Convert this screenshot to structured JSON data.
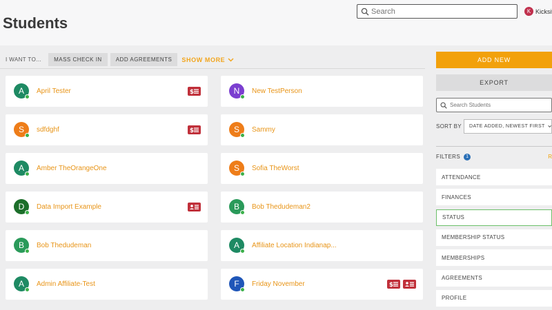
{
  "header": {
    "title": "Students",
    "search_placeholder": "Search",
    "user_initial": "K",
    "user_name": "Kicksite"
  },
  "actionbar": {
    "i_want_to": "I WANT TO...",
    "mass_check_in": "MASS CHECK IN",
    "add_agreements": "ADD AGREEMENTS",
    "show_more": "SHOW MORE"
  },
  "students": [
    {
      "initial": "A",
      "name": "April Tester",
      "avatar_color": "#1e8a63",
      "badges": [
        "finance-icon"
      ]
    },
    {
      "initial": "N",
      "name": "New TestPerson",
      "avatar_color": "#7b3fd0",
      "badges": []
    },
    {
      "initial": "S",
      "name": "sdfdghf",
      "avatar_color": "#ee7d19",
      "badges": [
        "finance-icon"
      ]
    },
    {
      "initial": "S",
      "name": "Sammy",
      "avatar_color": "#ee7d19",
      "badges": []
    },
    {
      "initial": "A",
      "name": "Amber TheOrangeOne",
      "avatar_color": "#1e8a63",
      "badges": []
    },
    {
      "initial": "S",
      "name": "Sofia TheWorst",
      "avatar_color": "#ee7d19",
      "badges": []
    },
    {
      "initial": "D",
      "name": "Data Import Example",
      "avatar_color": "#1c6e2a",
      "badges": [
        "id-card-icon"
      ]
    },
    {
      "initial": "B",
      "name": "Bob Thedudeman2",
      "avatar_color": "#2a9a5a",
      "badges": []
    },
    {
      "initial": "B",
      "name": "Bob Thedudeman",
      "avatar_color": "#2a9a5a",
      "badges": []
    },
    {
      "initial": "A",
      "name": "Affiliate Location Indianap...",
      "avatar_color": "#1e8a63",
      "badges": []
    },
    {
      "initial": "A",
      "name": "Admin Affiliate-Test",
      "avatar_color": "#1e8a63",
      "badges": []
    },
    {
      "initial": "F",
      "name": "Friday November",
      "avatar_color": "#1f56b8",
      "badges": [
        "finance-icon",
        "id-card-icon"
      ]
    }
  ],
  "sidebar": {
    "add_new": "ADD NEW",
    "export": "EXPORT",
    "search_placeholder": "Search Students",
    "sort_label": "SORT BY",
    "sort_value": "DATE ADDED, NEWEST FIRST",
    "filters_label": "FILTERS",
    "filters_count": "1",
    "filters_reset": "R",
    "filters": [
      "ATTENDANCE",
      "FINANCES",
      "STATUS",
      "MEMBERSHIP STATUS",
      "MEMBERSHIPS",
      "AGREEMENTS",
      "PROFILE"
    ],
    "active_filter": "STATUS"
  },
  "colors": {
    "accent": "#f2a10c",
    "link": "#e89417",
    "badge": "#c0303a",
    "online": "#3cb04a"
  }
}
